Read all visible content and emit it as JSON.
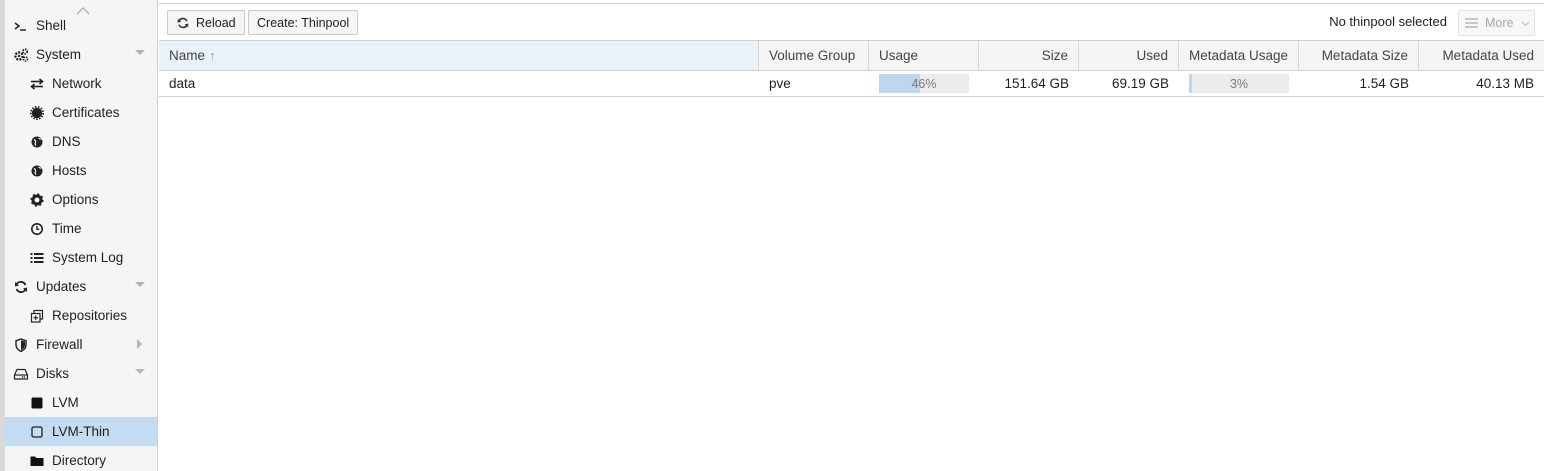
{
  "sidebar": {
    "items": [
      {
        "name": "nav-item-shell",
        "label": "Shell",
        "icon": "terminal-icon",
        "level": 1
      },
      {
        "name": "nav-item-system",
        "label": "System",
        "icon": "cogs-icon",
        "level": 1,
        "expander": "down"
      },
      {
        "name": "nav-item-network",
        "label": "Network",
        "icon": "exchange-icon",
        "level": 2
      },
      {
        "name": "nav-item-certificates",
        "label": "Certificates",
        "icon": "certificate-icon",
        "level": 2
      },
      {
        "name": "nav-item-dns",
        "label": "DNS",
        "icon": "globe-icon",
        "level": 2
      },
      {
        "name": "nav-item-hosts",
        "label": "Hosts",
        "icon": "globe-icon",
        "level": 2
      },
      {
        "name": "nav-item-options",
        "label": "Options",
        "icon": "gear-icon",
        "level": 2
      },
      {
        "name": "nav-item-time",
        "label": "Time",
        "icon": "clock-icon",
        "level": 2
      },
      {
        "name": "nav-item-system-log",
        "label": "System Log",
        "icon": "list-icon",
        "level": 2
      },
      {
        "name": "nav-item-updates",
        "label": "Updates",
        "icon": "refresh-icon",
        "level": 1,
        "expander": "down"
      },
      {
        "name": "nav-item-repositories",
        "label": "Repositories",
        "icon": "repositories-icon",
        "level": 2
      },
      {
        "name": "nav-item-firewall",
        "label": "Firewall",
        "icon": "shield-icon",
        "level": 1,
        "expander": "right"
      },
      {
        "name": "nav-item-disks",
        "label": "Disks",
        "icon": "hdd-icon",
        "level": 1,
        "expander": "down"
      },
      {
        "name": "nav-item-lvm",
        "label": "LVM",
        "icon": "square-filled-icon",
        "level": 2
      },
      {
        "name": "nav-item-lvm-thin",
        "label": "LVM-Thin",
        "icon": "square-outline-icon",
        "level": 2,
        "selected": true
      },
      {
        "name": "nav-item-directory",
        "label": "Directory",
        "icon": "folder-icon",
        "level": 2
      }
    ]
  },
  "toolbar": {
    "reload_label": "Reload",
    "create_label": "Create: Thinpool",
    "status_text": "No thinpool selected",
    "more_label": "More"
  },
  "grid": {
    "columns": [
      "Name",
      "Volume Group",
      "Usage",
      "Size",
      "Used",
      "Metadata Usage",
      "Metadata Size",
      "Metadata Used"
    ],
    "sort_arrow": "↑",
    "rows": [
      {
        "name": "data",
        "volume_group": "pve",
        "usage_label": "46%",
        "usage_fraction": 0.46,
        "size": "151.64 GB",
        "used": "69.19 GB",
        "metadata_usage_label": "3%",
        "metadata_usage_fraction": 0.03,
        "metadata_size": "1.54 GB",
        "metadata_used": "40.13 MB"
      }
    ]
  },
  "colors": {
    "selection": "#c3dcf2",
    "bar_fill": "#bed6ee",
    "bar_track": "#ececec"
  }
}
